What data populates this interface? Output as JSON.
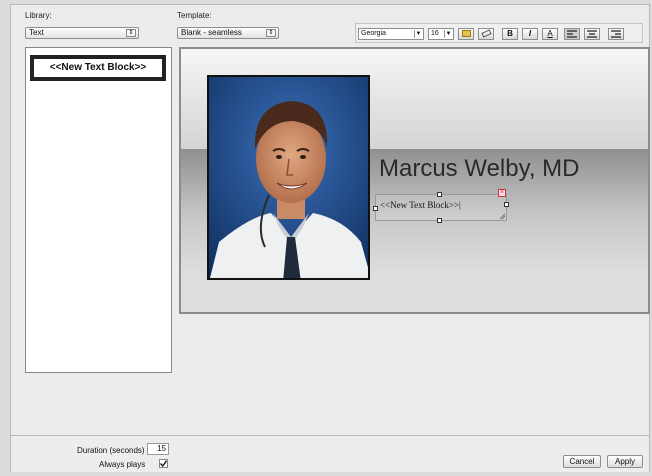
{
  "library": {
    "label": "Library:",
    "value": "Text"
  },
  "template": {
    "label": "Template:",
    "value": "Blank - seamless"
  },
  "toolbar": {
    "font": "Georgia",
    "size": "16",
    "bold": "B",
    "italic": "I",
    "underline": "A"
  },
  "library_panel": {
    "block_label": "<<New Text Block>>"
  },
  "stage": {
    "headline": "Marcus Welby, MD",
    "textbox_text": "<<New Text Block>>|"
  },
  "footer": {
    "duration_label": "Duration (seconds)",
    "duration_value": "15",
    "always_plays_label": "Always plays",
    "always_plays_checked": true,
    "cancel_label": "Cancel",
    "apply_label": "Apply"
  },
  "colors": {
    "photo_background": "#1e4a8a",
    "accent_yellow": "#e8c24a"
  }
}
